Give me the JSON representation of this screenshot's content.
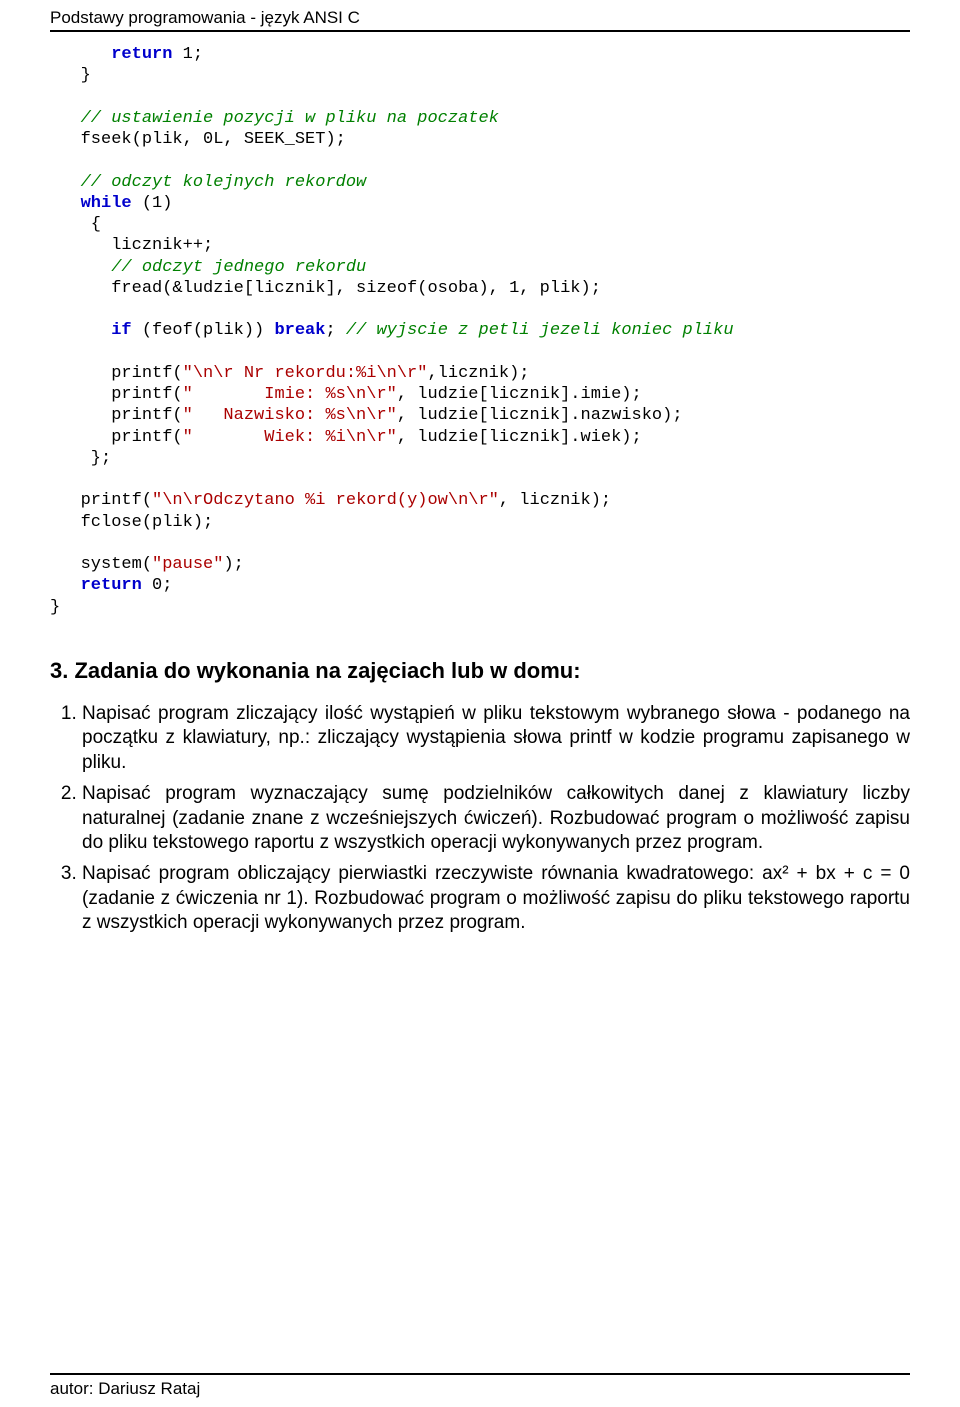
{
  "header": {
    "title": "Podstawy programowania - język ANSI C"
  },
  "footer": {
    "author": "autor: Dariusz Rataj"
  },
  "code": {
    "l1": "return",
    "l1b": " 1;",
    "l2": "   }",
    "blank": "",
    "l3a": "   ",
    "l3": "// ustawienie pozycji w pliku na poczatek",
    "l4": "   fseek(plik, 0L, SEEK_SET);",
    "l5a": "   ",
    "l5": "// odczyt kolejnych rekordow",
    "l6a": "   ",
    "l6kw": "while",
    "l6b": " (1)",
    "l7": "    {",
    "l8": "      licznik++;",
    "l9a": "      ",
    "l9": "// odczyt jednego rekordu",
    "l10": "      fread(&ludzie[licznik], sizeof(osoba), 1, plik);",
    "l11a": "      ",
    "l11if": "if",
    "l11b": " (feof(plik)) ",
    "l11br": "break",
    "l11c": "; ",
    "l11com": "// wyjscie z petli jezeli koniec pliku",
    "l12a": "      printf(",
    "l12s": "\"\\n\\r Nr rekordu:%i\\n\\r\"",
    "l12b": ",licznik);",
    "l13a": "      printf(",
    "l13s": "\"       Imie: %s\\n\\r\"",
    "l13b": ", ludzie[licznik].imie);",
    "l14a": "      printf(",
    "l14s": "\"   Nazwisko: %s\\n\\r\"",
    "l14b": ", ludzie[licznik].nazwisko);",
    "l15a": "      printf(",
    "l15s": "\"       Wiek: %i\\n\\r\"",
    "l15b": ", ludzie[licznik].wiek);",
    "l16": "    };",
    "l17a": "   printf(",
    "l17s": "\"\\n\\rOdczytano %i rekord(y)ow\\n\\r\"",
    "l17b": ", licznik);",
    "l18": "   fclose(plik);",
    "l19a": "   system(",
    "l19s": "\"pause\"",
    "l19b": ");",
    "l20a": "   ",
    "l20kw": "return",
    "l20b": " 0;",
    "l21": "}"
  },
  "section": {
    "title": "3.  Zadania do wykonania na zajęciach lub w domu:",
    "tasks": [
      "Napisać program zliczający ilość wystąpień w pliku tekstowym wybranego słowa - podanego na początku z klawiatury, np.: zliczający wystąpienia słowa printf w kodzie programu zapisanego w pliku.",
      "Napisać program wyznaczający sumę podzielników całkowitych danej z klawiatury liczby naturalnej (zadanie znane z wcześniejszych ćwiczeń). Rozbudować program o możliwość zapisu do pliku tekstowego raportu z wszystkich operacji wykonywanych przez program.",
      "Napisać program obliczający pierwiastki rzeczywiste równania kwadratowego: ax² + bx + c = 0 (zadanie z ćwiczenia nr 1). Rozbudować program o możliwość zapisu do pliku tekstowego raportu z wszystkich operacji wykonywanych przez program."
    ]
  }
}
